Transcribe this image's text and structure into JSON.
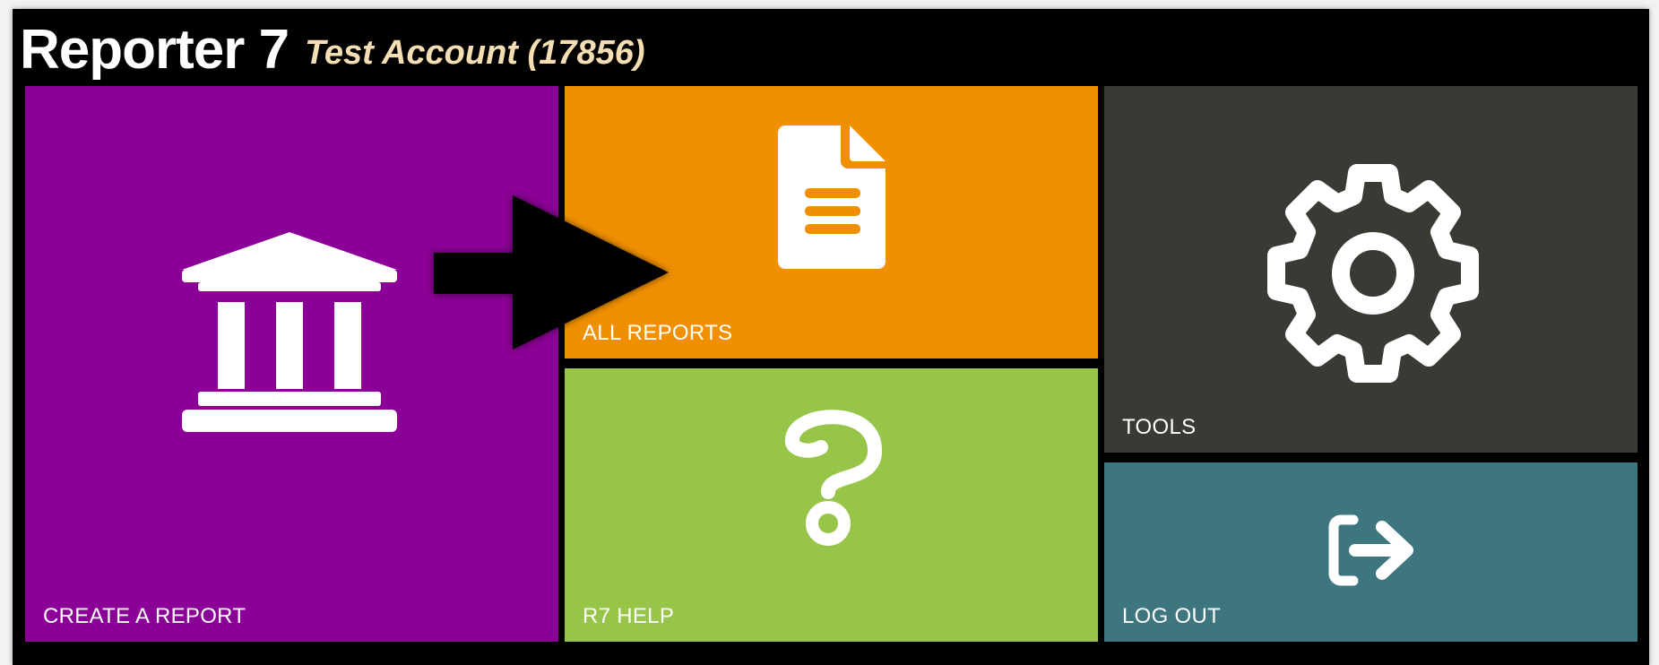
{
  "header": {
    "app_title": "Reporter 7",
    "account_name": "Test Account (17856)"
  },
  "tiles": {
    "create_report": {
      "label": "CREATE A REPORT",
      "icon": "bank-building-icon",
      "color": "#8b0096"
    },
    "all_reports": {
      "label": "ALL REPORTS",
      "icon": "document-icon",
      "color": "#f09000"
    },
    "r7_help": {
      "label": "R7 HELP",
      "icon": "question-mark-icon",
      "color": "#97c54a"
    },
    "tools": {
      "label": "TOOLS",
      "icon": "gear-icon",
      "color": "#3a3a34"
    },
    "log_out": {
      "label": "LOG OUT",
      "icon": "logout-arrow-icon",
      "color": "#3e7680"
    }
  },
  "annotation": {
    "icon": "black-arrow-pointer",
    "color": "#000000"
  }
}
